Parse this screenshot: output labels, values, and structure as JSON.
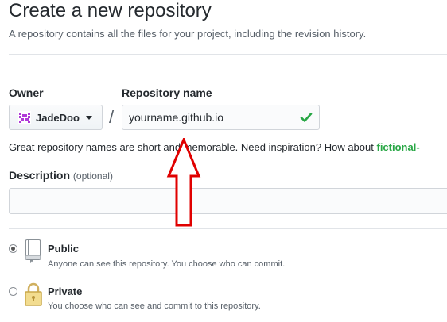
{
  "page": {
    "title": "Create a new repository",
    "subtitle": "A repository contains all the files for your project, including the revision history."
  },
  "owner": {
    "label": "Owner",
    "selected": "JadeDoo"
  },
  "repo": {
    "label": "Repository name",
    "value": "yourname.github.io",
    "separator": "/"
  },
  "hint": {
    "text": "Great repository names are short and memorable. Need inspiration? How about",
    "suggestion": "fictional-"
  },
  "description": {
    "label": "Description",
    "optional": "(optional)",
    "value": ""
  },
  "visibility": {
    "public": {
      "title": "Public",
      "desc": "Anyone can see this repository. You choose who can commit."
    },
    "private": {
      "title": "Private",
      "desc": "You choose who can see and commit to this repository."
    }
  },
  "colors": {
    "success": "#28a745",
    "annotation_arrow": "#e00000"
  }
}
